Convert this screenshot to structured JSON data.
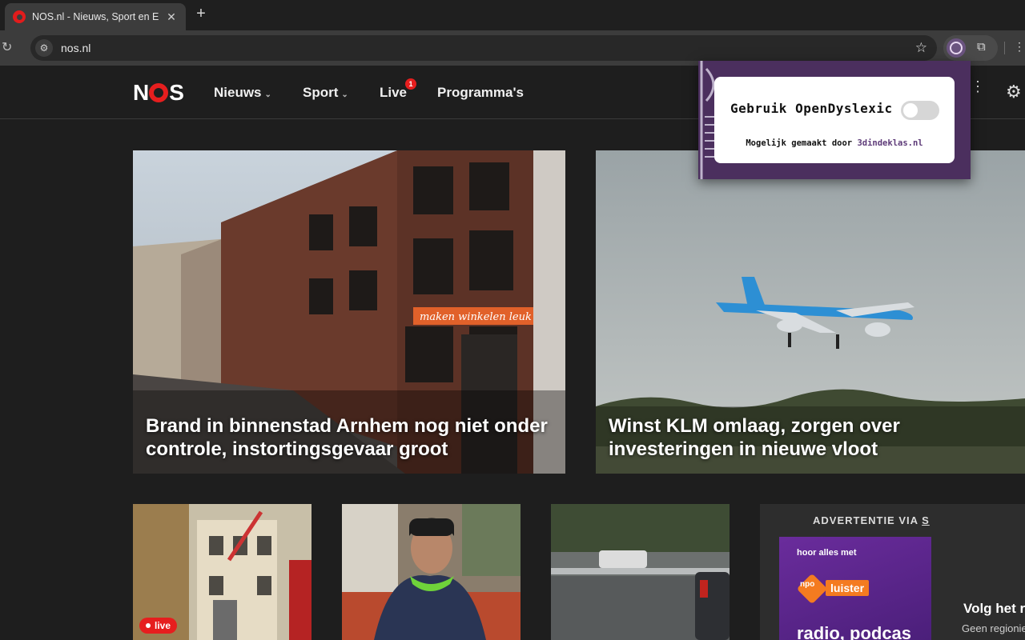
{
  "browser": {
    "tab_title": "NOS.nl - Nieuws, Sport en Ev",
    "tab_close": "✕",
    "new_tab": "+",
    "url": "nos.nl"
  },
  "site": {
    "logo_n": "N",
    "logo_s": "S",
    "nav": [
      {
        "label": "Nieuws",
        "has_chevron": true
      },
      {
        "label": "Sport",
        "has_chevron": true
      },
      {
        "label": "Live",
        "badge": "1"
      },
      {
        "label": "Programma's"
      }
    ]
  },
  "hero": [
    {
      "title": "Brand in binnenstad Arnhem nog niet onder controle, instortingsgevaar groot"
    },
    {
      "title": "Winst KLM omlaag, zorgen over investeringen in nieuwe vloot"
    }
  ],
  "small_cards": {
    "live_label": "live"
  },
  "ad": {
    "label_prefix": "ADVERTENTIE VIA ",
    "label_cut": "S",
    "small_text": "hoor alles met",
    "npo_mark": "npo",
    "npo_text": "luister",
    "big_text": "radio, podcas"
  },
  "follow": {
    "title": "Volg het r",
    "subtitle": "Geen regionie"
  },
  "extension_popup": {
    "label": "Gebruik OpenDyslexic",
    "toggle_on": false,
    "credit_prefix": "Mogelijk gemaakt door ",
    "credit_link": "3dindeklas.nl"
  },
  "colors": {
    "brand_red": "#e61e1e",
    "popup_purple": "#4b2f5e",
    "background": "#1e1e1e"
  }
}
